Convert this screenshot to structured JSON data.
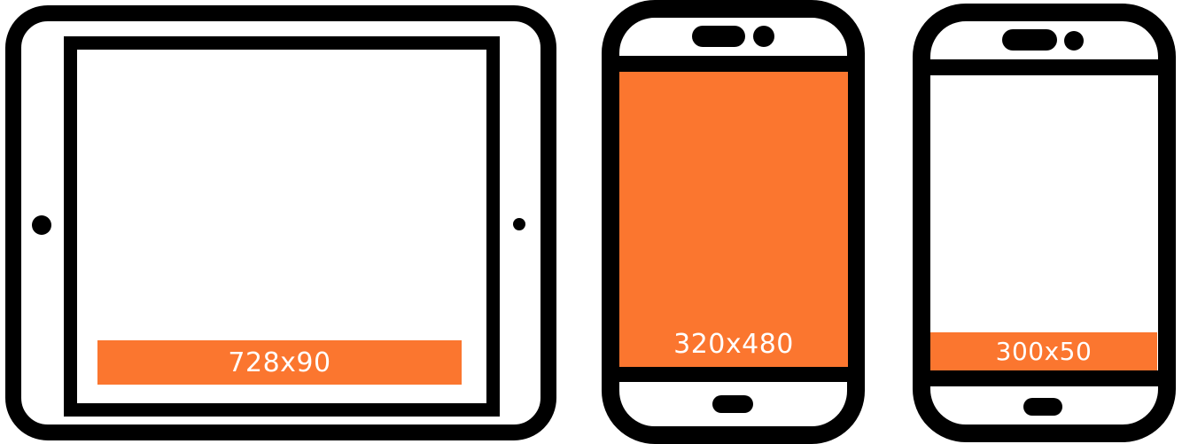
{
  "colors": {
    "outline": "#000000",
    "screen": "#ffffff",
    "ad_fill": "#fb762f",
    "ad_text": "#ffffff"
  },
  "devices": [
    {
      "kind": "tablet",
      "ad_label": "728x90"
    },
    {
      "kind": "phone",
      "ad_label": "320x480"
    },
    {
      "kind": "phone",
      "ad_label": "300x50"
    }
  ]
}
